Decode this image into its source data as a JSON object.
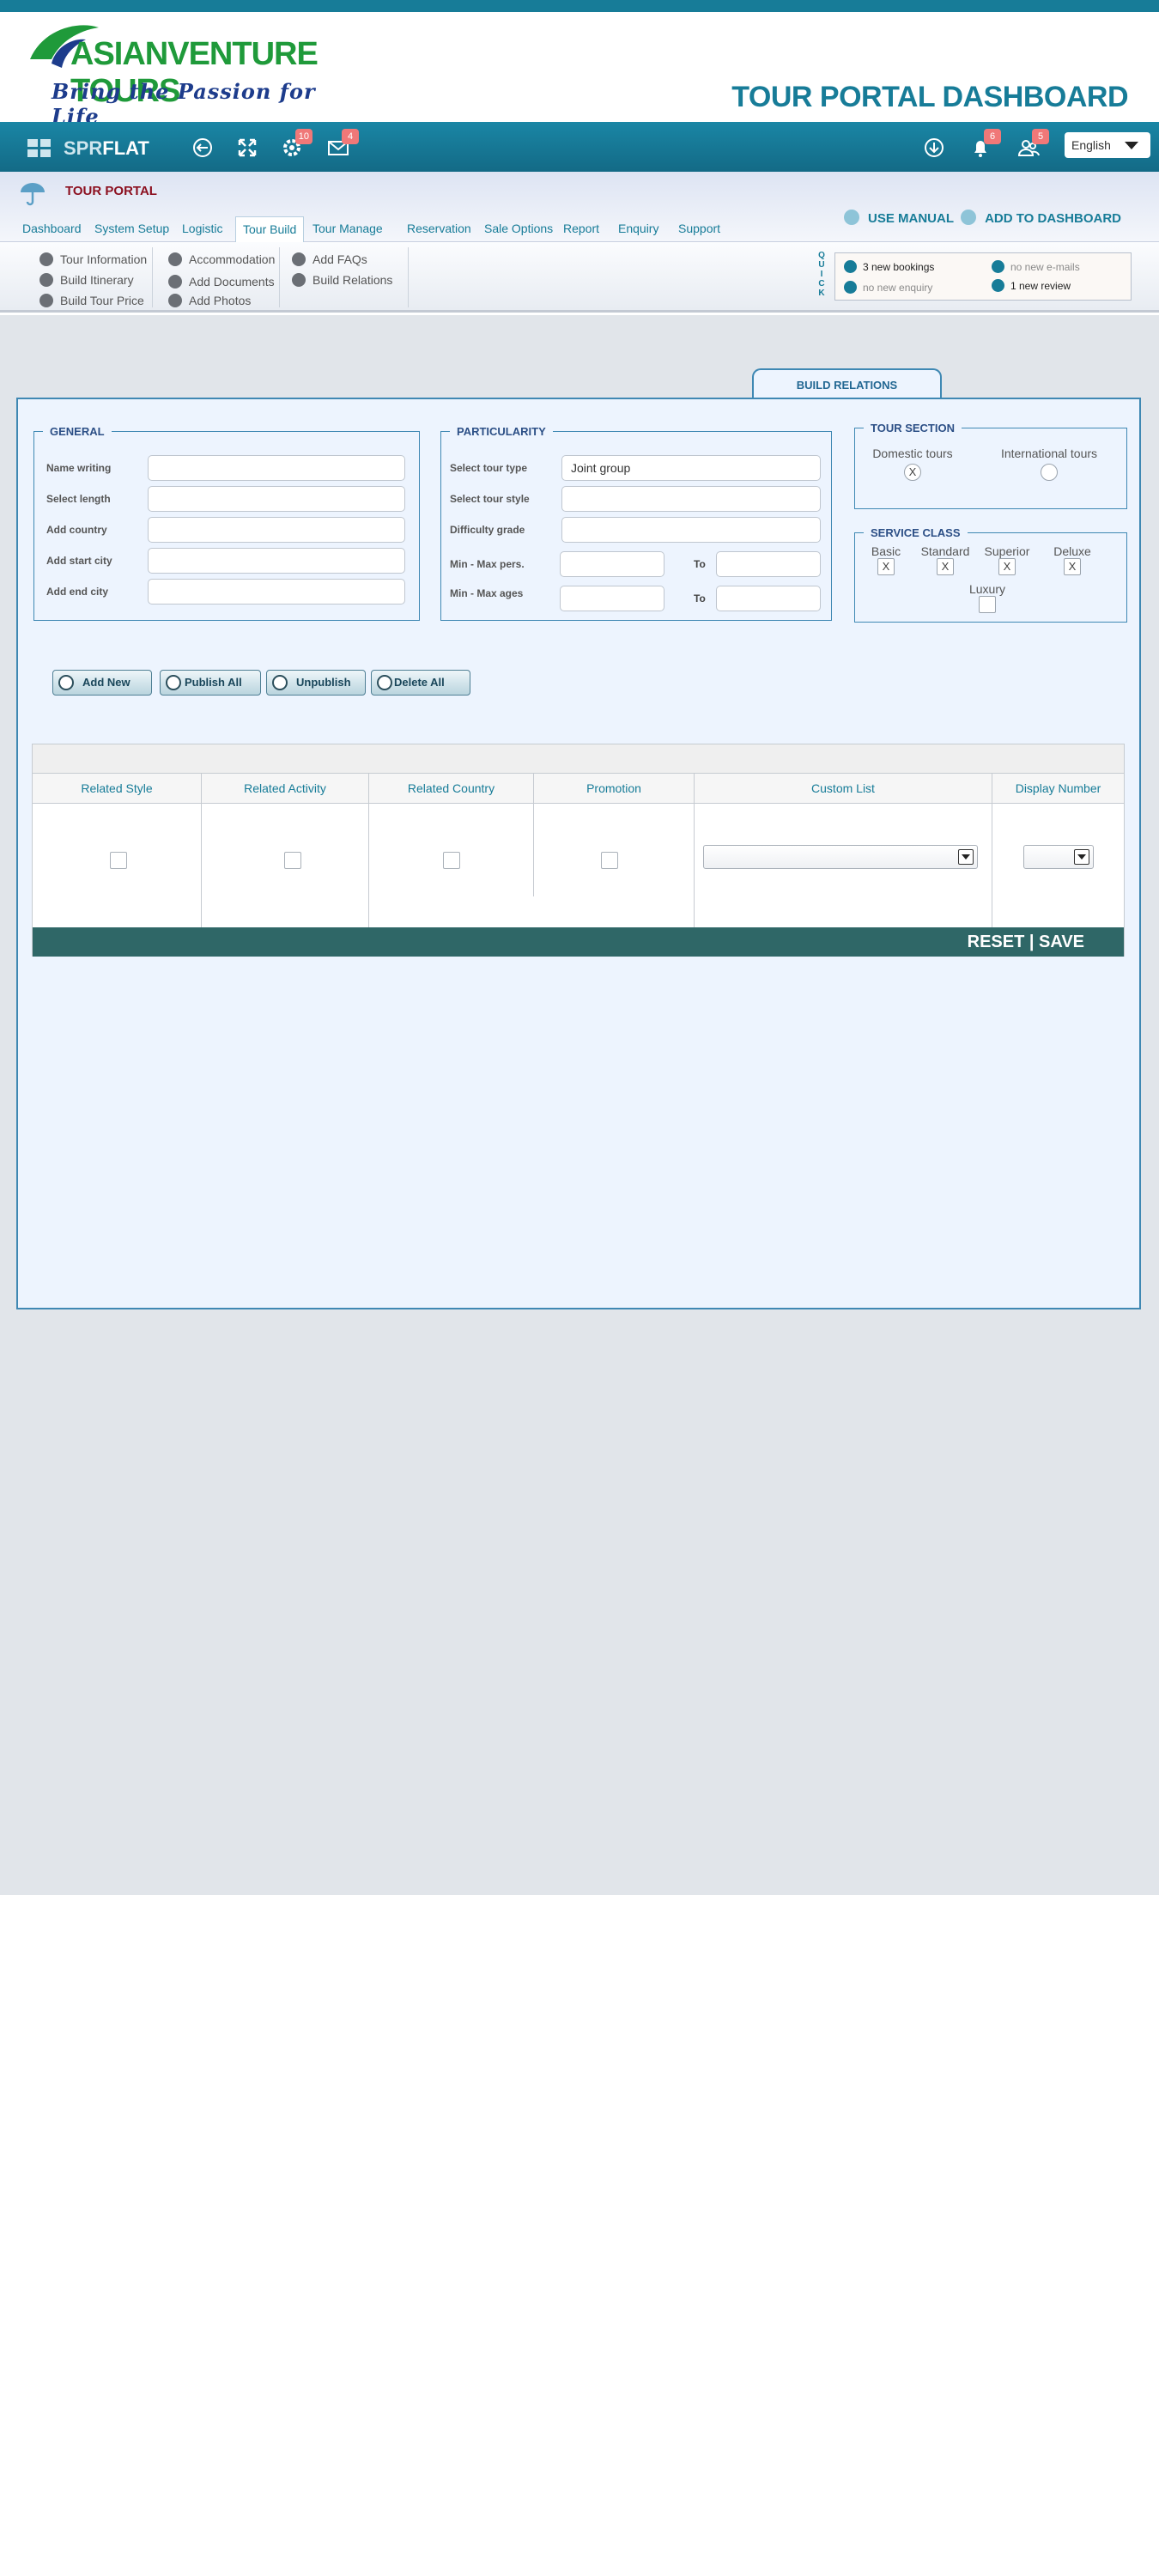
{
  "brand": {
    "name": "ASIANVENTURE TOURS",
    "tagline": "Bring the Passion for Life",
    "page_title": "TOUR PORTAL DASHBOARD"
  },
  "topbar": {
    "logo_prefix": "SPR",
    "logo_suffix": "FLAT",
    "settings_badge": "10",
    "mail_badge": "4",
    "notifications_badge": "6",
    "users_badge": "5",
    "language": "English"
  },
  "portal": {
    "label": "TOUR PORTAL",
    "use_manual": "USE MANUAL",
    "add_to_dashboard": "ADD TO  DASHBOARD"
  },
  "menu": [
    "Dashboard",
    "System Setup",
    "Logistic",
    "Tour Build",
    "Tour Manage",
    "Reservation",
    "Sale Options",
    "Report",
    "Enquiry",
    "Support"
  ],
  "submenu": {
    "col1": [
      "Tour Information",
      "Build Itinerary",
      "Build Tour Price"
    ],
    "col2": [
      "Accommodation",
      "Add Documents",
      "Add Photos"
    ],
    "col3": [
      "Add FAQs",
      "Build Relations"
    ]
  },
  "quick": {
    "letters": [
      "Q",
      "U",
      "I",
      "C",
      "K"
    ],
    "bookings": "3 new bookings",
    "emails": "no new e-mails",
    "enquiry": "no new enquiry",
    "review": "1 new review"
  },
  "active_tab": "BUILD RELATIONS",
  "general": {
    "legend": "GENERAL",
    "fields": [
      "Name writing",
      "Select length",
      "Add  country",
      "Add start city",
      "Add end  city"
    ]
  },
  "particularity": {
    "legend": "PARTICULARITY",
    "select_tour_type_label": "Select tour  type",
    "select_tour_type_value": "Joint group",
    "select_tour_style_label": "Select tour  style",
    "difficulty_label": "Difficulty  grade",
    "min_max_pers_label": "Min - Max  pers.",
    "min_max_ages_label": "Min - Max  ages",
    "to": "To"
  },
  "tour_section": {
    "legend": "TOUR SECTION",
    "domestic": "Domestic tours",
    "domestic_mark": "X",
    "international": "International  tours"
  },
  "service_class": {
    "legend": "SERVICE CLASS",
    "mark": "X",
    "basic": "Basic",
    "standard": "Standard",
    "superior": "Superior",
    "deluxe": "Deluxe",
    "luxury": "Luxury"
  },
  "actions": {
    "add_new": "Add New",
    "publish_all": "Publish All",
    "unpublish": "Unpublish",
    "delete_all": "Delete All"
  },
  "table": {
    "columns": [
      "Related Style",
      "Related Activity",
      "Related Country",
      "Promotion",
      "Custom List",
      "Display Number"
    ],
    "save_label": "RESET | SAVE"
  }
}
